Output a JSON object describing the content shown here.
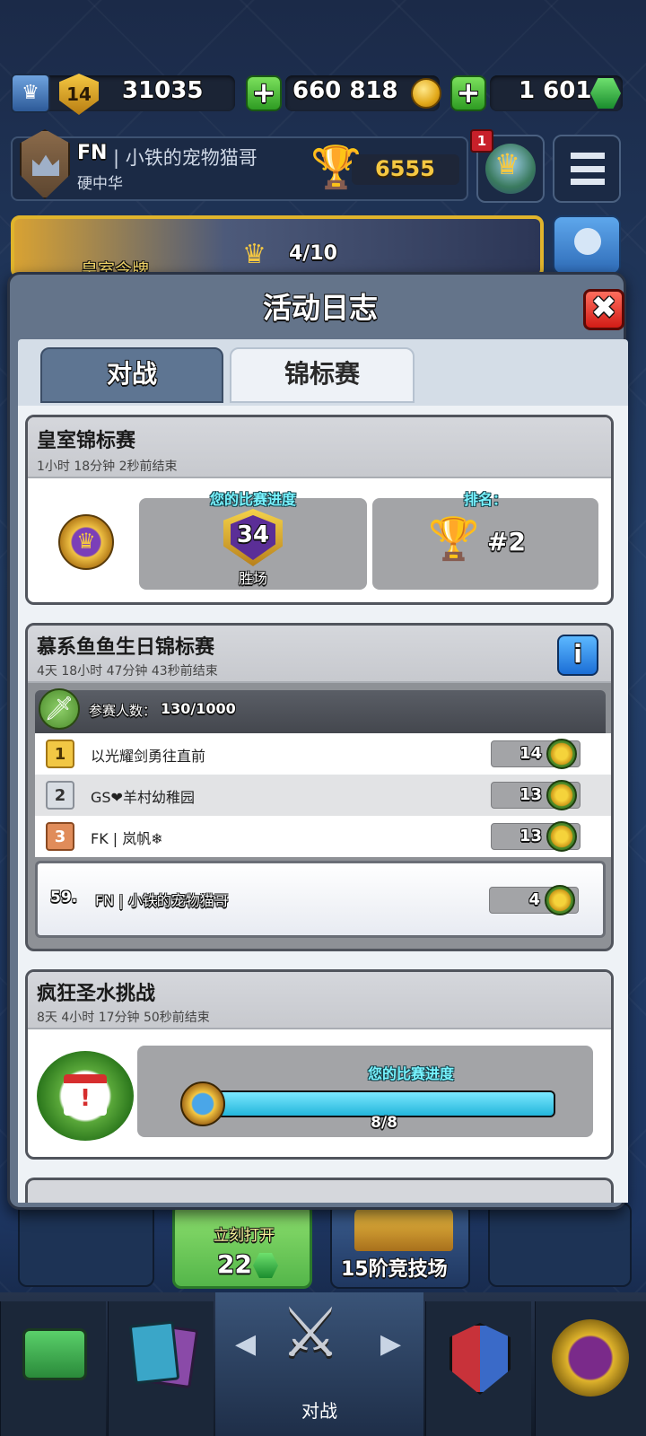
{
  "top_bar": {
    "level": "14",
    "xp": "31035",
    "gold": "660 818",
    "gems": "1 601",
    "plus_label": "+"
  },
  "profile": {
    "clan_tag": "FN",
    "name": "| 小铁的宠物猫哥",
    "clan": "硬中华",
    "trophies": "6555",
    "notification": "1"
  },
  "banner": {
    "progress": "4/10",
    "label": "皇室令牌"
  },
  "modal": {
    "title": "活动日志",
    "close_label": "✖",
    "tabs": [
      {
        "label": "对战",
        "active": false
      },
      {
        "label": "锦标赛",
        "active": true
      }
    ],
    "royal": {
      "title": "皇室锦标赛",
      "ended": "1小时 18分钟  2秒前结束",
      "progress_label": "您的比赛进度",
      "wins": "34",
      "wins_label": "胜场",
      "rank_label": "排名：",
      "rank": "#2"
    },
    "tournament": {
      "title": "慕系鱼鱼生日锦标赛",
      "ended": "4天 18小时 47分钟  43秒前结束",
      "info_label": "i",
      "participants_label": "参赛人数：",
      "participants": "130/1000",
      "rows": [
        {
          "rank": "1",
          "name": "以光耀剑勇往直前",
          "score": "14"
        },
        {
          "rank": "2",
          "name": "GS❤羊村幼稚园",
          "score": "13"
        },
        {
          "rank": "3",
          "name": "FK | 岚帆❄",
          "score": "13"
        }
      ],
      "me": {
        "rank": "59.",
        "name": "FN | 小铁的宠物猫哥",
        "score": "4"
      }
    },
    "challenge": {
      "title": "疯狂圣水挑战",
      "ended": "8天 4小时 17分钟  50秒前结束",
      "progress_label": "您的比赛进度",
      "progress": "8/8",
      "progress_fraction": 1.0
    }
  },
  "chests": {
    "open_now": "立刻打开",
    "open_cost": "22",
    "arena_label": "15阶竞技场"
  },
  "bottom_nav": {
    "battle_label": "对战"
  },
  "colors": {
    "accent_cyan": "#2fc7e6",
    "gold": "#e0b42c",
    "close_red": "#d21c16"
  }
}
